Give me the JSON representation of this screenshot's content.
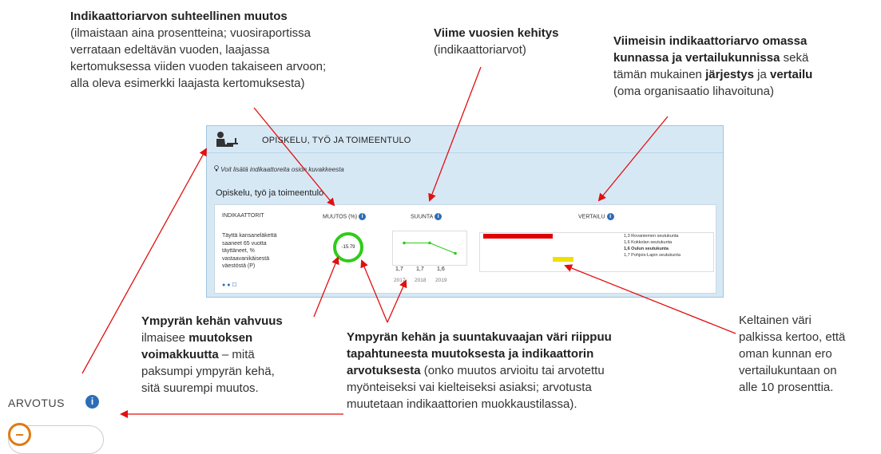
{
  "annotations": {
    "relative_change": {
      "title": "Indikaattoriarvon suhteellinen muutos",
      "lines": [
        "(ilmaistaan aina prosentteina; vuosiraportissa",
        "verrataan edeltävän vuoden, laajassa",
        "kertomuksessa viiden vuoden takaiseen arvoon;",
        "alla oleva esimerkki laajasta kertomuksesta)"
      ]
    },
    "recent_trend": {
      "title": "Viime vuosien kehitys",
      "sub": "(indikaattoriarvot)"
    },
    "latest_value": {
      "line1": "Viimeisin indikaattoriarvo omassa",
      "line2_bold": "kunnassa ja vertailukunnissa",
      "line2_rest": " sekä",
      "line3_a": "tämän mukainen ",
      "line3_b": "järjestys",
      "line3_c": " ja ",
      "line3_d": "vertailu",
      "line4": "(oma organisaatio lihavoituna)"
    },
    "circle_width": {
      "line1": "Ympyrän kehän vahvuus",
      "line2_a": "ilmaisee ",
      "line2_b": "muutoksen",
      "line3_a": "voimakkuutta",
      "line3_b": " – mitä",
      "line4": "paksumpi ympyrän kehä,",
      "line5": "sitä suurempi muutos."
    },
    "circle_color": {
      "line1": "Ympyrän kehän ja suuntakuvaajan väri riippuu",
      "line2": "tapahtuneesta muutoksesta ja indikaattorin",
      "line3_a": "arvotuksesta",
      "line3_b": " (onko muutos arvioitu tai arvotettu",
      "line4": "myönteiseksi vai kielteiseksi asiaksi; arvotusta",
      "line5": "muutetaan indikaattorien muokkaustilassa)."
    },
    "yellow_bar": {
      "lines": [
        "Keltainen väri",
        "palkissa kertoo, että",
        "oman kunnan ero",
        "vertailukuntaan on",
        "alle 10 prosenttia."
      ]
    }
  },
  "panel": {
    "title": "OPISKELU, TYÖ JA TOIMEENTULO",
    "hint": "Voit lisätä indikaattoreita osion kuvakkeesta",
    "section_title": "Opiskelu, työ ja toimeentulo",
    "columns": {
      "indicators": "INDIKAATTORIT",
      "change": "MUUTOS (%)",
      "direction": "SUUNTA",
      "comparison": "VERTAILU"
    },
    "indicator_lines": [
      "Täyttä kansaneläkettä",
      "saaneet 65 vuotta",
      "täyttäneet, %",
      "vastaavanikäisestä",
      "väestöstä (P)"
    ],
    "change_value": "-15.79",
    "trend": {
      "values": [
        "1,7",
        "1,7",
        "1,6"
      ],
      "years": [
        "2017",
        "2018",
        "2019"
      ],
      "points": [
        1.7,
        1.7,
        1.6
      ]
    },
    "comparison_list": [
      {
        "text": "1,3 Rovaniemen seutukunta",
        "bold": false
      },
      {
        "text": "1,6 Kokkolan seutukunta",
        "bold": false
      },
      {
        "text": "1,6 Oulun seutukunta",
        "bold": true
      },
      {
        "text": "1,7 Pohjois-Lapin seutukunta",
        "bold": false
      }
    ],
    "colors": {
      "circle": "#2ecc1a",
      "red_bar": "#e00000",
      "yellow_bar": "#f0e000",
      "arrow": "#e01010"
    }
  },
  "arvotus": {
    "label": "ARVOTUS",
    "info_icon": "i",
    "toggle_symbol": "−"
  }
}
